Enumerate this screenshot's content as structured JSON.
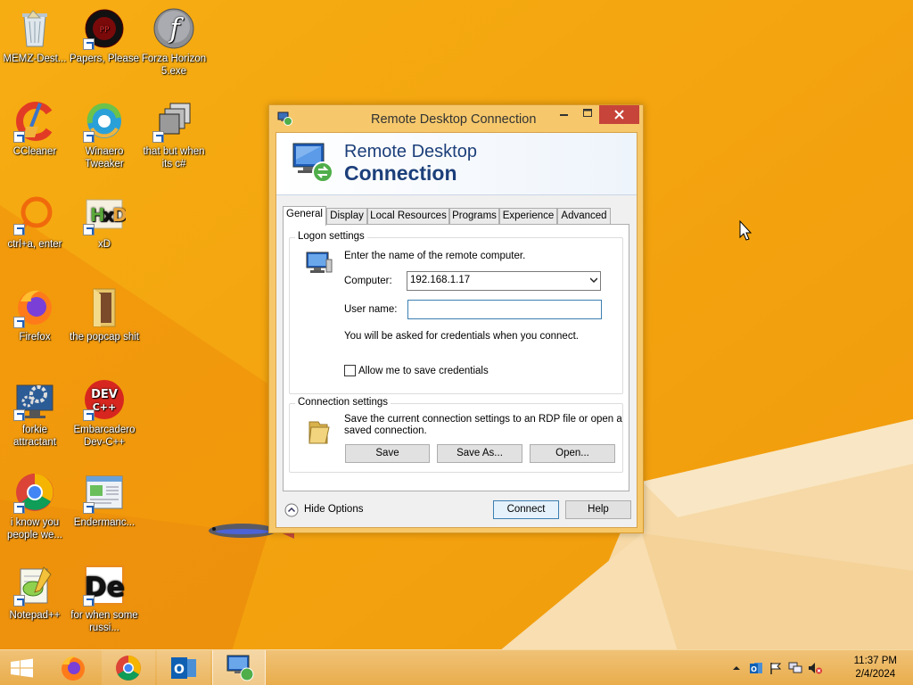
{
  "desktop": {
    "icons": [
      {
        "label": "MEMZ-Dest..."
      },
      {
        "label": "Papers, Please"
      },
      {
        "label": "Forza Horizon 5.exe"
      },
      {
        "label": "CCleaner"
      },
      {
        "label": "Winaero Tweaker"
      },
      {
        "label": "that but when its c#"
      },
      {
        "label": "ctrl+a, enter"
      },
      {
        "label": "xD"
      },
      {
        "label": "Firefox"
      },
      {
        "label": "the popcap shit"
      },
      {
        "label": "forkie attractant"
      },
      {
        "label": "Embarcadero Dev-C++"
      },
      {
        "label": "i know you people we..."
      },
      {
        "label": "Endermanc..."
      },
      {
        "label": "Notepad++"
      },
      {
        "label": "for when some russi..."
      }
    ]
  },
  "window": {
    "title": "Remote Desktop Connection",
    "banner_line1": "Remote Desktop",
    "banner_line2": "Connection",
    "tabs": [
      {
        "label": "General"
      },
      {
        "label": "Display"
      },
      {
        "label": "Local Resources"
      },
      {
        "label": "Programs"
      },
      {
        "label": "Experience"
      },
      {
        "label": "Advanced"
      }
    ],
    "logon": {
      "title": "Logon settings",
      "instruction": "Enter the name of the remote computer.",
      "computer_label": "Computer:",
      "computer_value": "192.168.1.17",
      "username_label": "User name:",
      "username_value": "",
      "credentials_note": "You will be asked for credentials when you connect.",
      "allow_save_label": "Allow me to save credentials",
      "allow_save_checked": false
    },
    "connection": {
      "title": "Connection settings",
      "description_line1": "Save the current connection settings to an RDP file or open a",
      "description_line2": "saved connection.",
      "save_label": "Save",
      "save_as_label": "Save As...",
      "open_label": "Open..."
    },
    "hide_options_label": "Hide Options",
    "connect_label": "Connect",
    "help_label": "Help"
  },
  "taskbar": {
    "apps": [
      "start-icon",
      "firefox-icon",
      "chrome-icon",
      "outlook-icon",
      "remote-desktop-icon"
    ],
    "time": "11:37 PM",
    "date": "2/4/2024"
  },
  "colors": {
    "wallpaper": "#f3a20e",
    "banner_text": "#1c3f7a",
    "close_button": "#c7443a",
    "focus_border": "#3c7fb1"
  }
}
